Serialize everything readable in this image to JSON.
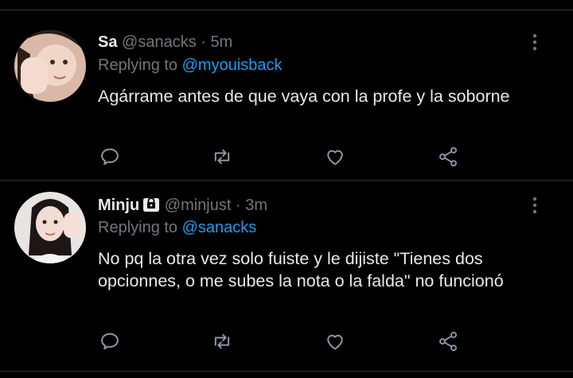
{
  "tweets": [
    {
      "name": "Sa",
      "handle": "@sanacks",
      "sep": "·",
      "time": "5m",
      "replying_prefix": "Replying to",
      "replying_to": "@myouisback",
      "text": "Agárrame antes de que vaya con la profe y la soborne",
      "protected": false,
      "actions": [
        "reply-icon",
        "retweet-icon",
        "like-icon",
        "share-icon"
      ]
    },
    {
      "name": "Minju",
      "handle": "@minjust",
      "sep": "·",
      "time": "3m",
      "replying_prefix": "Replying to",
      "replying_to": "@sanacks",
      "text": "No pq la otra vez solo fuiste y le dijiste \"Tienes dos opcionnes, o me subes la nota o la falda\" no funcionó",
      "protected": true,
      "actions": [
        "reply-icon",
        "retweet-icon",
        "like-icon",
        "share-icon"
      ]
    }
  ],
  "colors": {
    "background": "#000000",
    "text": "#e7e9ea",
    "muted": "#71767b",
    "link": "#1d9bf0",
    "divider": "#2f3336"
  }
}
